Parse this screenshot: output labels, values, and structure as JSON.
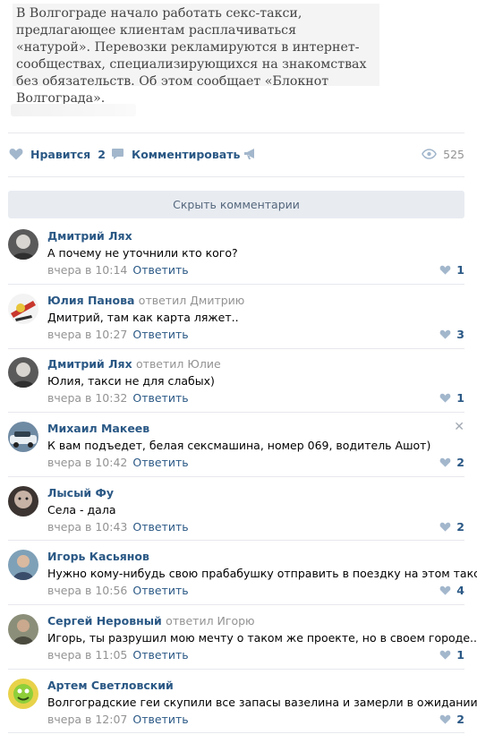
{
  "post": {
    "text": "В Волгограде начало работать секс-такси, предлагающее клиентам расплачиваться «натурой». Перевозки рекламируются в интернет-сообществах, специализирующихся на знакомствах без обязательств. Об этом сообщает «Блокнот Волгограда»."
  },
  "actions": {
    "like_label": "Нравится",
    "like_count": "2",
    "comment_label": "Комментировать",
    "share_icon": "megaphone-icon",
    "views": "525"
  },
  "hide_comments_label": "Скрыть комментарии",
  "comments": [
    {
      "author": "Дмитрий Лях",
      "reply_to": "",
      "text": "А почему не уточнили кто кого?",
      "time": "вчера в 10:14",
      "reply_label": "Ответить",
      "likes": "1"
    },
    {
      "author": "Юлия Панова",
      "reply_to": "ответил Дмитрию",
      "text": "Дмитрий, там как карта ляжет..",
      "time": "вчера в 10:27",
      "reply_label": "Ответить",
      "likes": "3"
    },
    {
      "author": "Дмитрий Лях",
      "reply_to": "ответил Юлие",
      "text": "Юлия, такси не для слабых)",
      "time": "вчера в 10:32",
      "reply_label": "Ответить",
      "likes": "1"
    },
    {
      "author": "Михаил Макеев",
      "reply_to": "",
      "text": "К вам подъедет, белая сексмашина, номер 069, водитель Ашот)",
      "time": "вчера в 10:42",
      "reply_label": "Ответить",
      "likes": "2"
    },
    {
      "author": "Лысый Фу",
      "reply_to": "",
      "text": "Села - дала",
      "time": "вчера в 10:43",
      "reply_label": "Ответить",
      "likes": "2"
    },
    {
      "author": "Игорь Касьянов",
      "reply_to": "",
      "text": "Нужно кому-нибудь свою прабабушку отправить в поездку на этом такси",
      "time": "вчера в 10:56",
      "reply_label": "Ответить",
      "likes": "4"
    },
    {
      "author": "Сергей Неровный",
      "reply_to": "ответил Игорю",
      "text": "Игорь, ты разрушил мою мечту о таком же проекте, но в своем городе.....",
      "time": "вчера в 11:05",
      "reply_label": "Ответить",
      "likes": "1"
    },
    {
      "author": "Артем Светловский",
      "reply_to": "",
      "text": "Волгоградские геи скупили все запасы вазелина и замерли в ожидании...",
      "time": "вчера в 12:07",
      "reply_label": "Ответить",
      "likes": "2"
    }
  ],
  "colors": {
    "link": "#2a5885",
    "meta": "#939393",
    "heart": "#a3b7cc"
  }
}
